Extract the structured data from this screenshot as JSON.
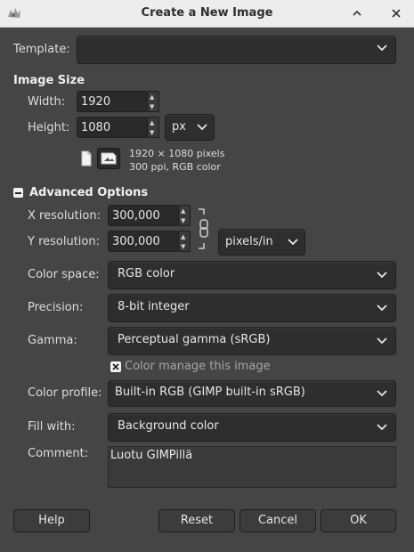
{
  "window": {
    "title": "Create a New Image"
  },
  "template": {
    "label": "Template:",
    "value": ""
  },
  "image_size": {
    "heading": "Image Size",
    "width_label": "Width:",
    "width_value": "1920",
    "height_label": "Height:",
    "height_value": "1080",
    "unit": "px",
    "info_line1": "1920 × 1080 pixels",
    "info_line2": "300 ppi, RGB color"
  },
  "advanced": {
    "heading": "Advanced Options",
    "xres_label": "X resolution:",
    "xres_value": "300,000",
    "yres_label": "Y resolution:",
    "yres_value": "300,000",
    "res_unit": "pixels/in",
    "color_space_label": "Color space:",
    "color_space_value": "RGB color",
    "precision_label": "Precision:",
    "precision_value": "8-bit integer",
    "gamma_label": "Gamma:",
    "gamma_value": "Perceptual gamma (sRGB)",
    "color_manage_label": "Color manage this image",
    "color_manage_checked": true,
    "color_profile_label": "Color profile:",
    "color_profile_value": "Built-in RGB (GIMP built-in sRGB)",
    "fill_label": "Fill with:",
    "fill_value": "Background color",
    "comment_label": "Comment:",
    "comment_value": "Luotu GIMPillä"
  },
  "buttons": {
    "help": "Help",
    "reset": "Reset",
    "cancel": "Cancel",
    "ok": "OK"
  },
  "icons": [
    "gimp-icon",
    "maximize-icon",
    "close-icon",
    "portrait-icon",
    "landscape-icon",
    "chain-link-icon",
    "checkbox-icon",
    "collapse-icon",
    "chevron-down-icon"
  ]
}
